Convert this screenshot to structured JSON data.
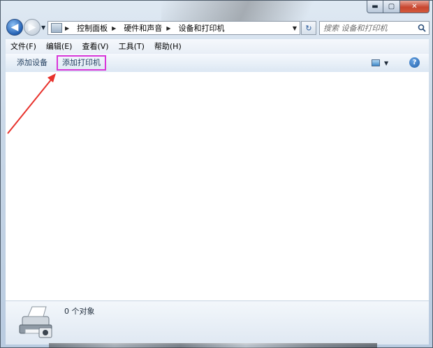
{
  "window": {
    "caption": {
      "minimize": "▬",
      "maximize": "▢",
      "close": "✕"
    }
  },
  "nav": {
    "back": "◀",
    "forward": "▶",
    "history_dropdown": "▼",
    "breadcrumbs": [
      "控制面板",
      "硬件和声音",
      "设备和打印机"
    ],
    "breadcrumb_separator": "▶",
    "address_dropdown": "▼",
    "refresh": "↻",
    "search_placeholder": "搜索 设备和打印机"
  },
  "menu": {
    "items": [
      "文件(F)",
      "编辑(E)",
      "查看(V)",
      "工具(T)",
      "帮助(H)"
    ]
  },
  "toolbar": {
    "add_device": "添加设备",
    "add_printer": "添加打印机",
    "views_dropdown": "▼",
    "help": "?"
  },
  "details": {
    "count": "0 个对象"
  },
  "colors": {
    "highlight_box": "#d936d9",
    "annotation_arrow": "#e8322c"
  },
  "icons": {
    "back": "back-arrow-icon",
    "forward": "forward-arrow-icon",
    "address": "control-panel-icon",
    "search": "search-icon",
    "views": "change-view-icon",
    "help": "help-icon",
    "printer": "printer-icon"
  }
}
